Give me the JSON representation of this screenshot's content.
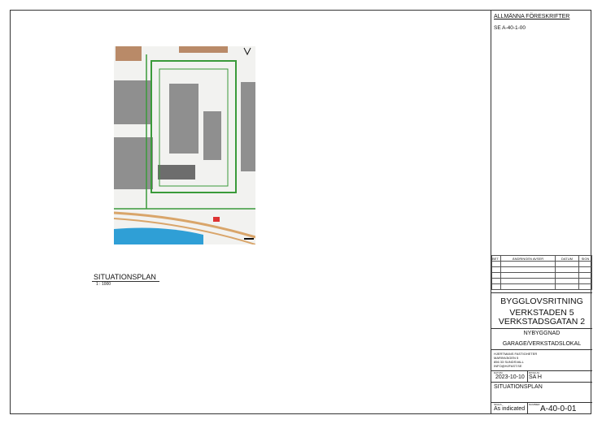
{
  "notes": {
    "heading": "ALLMÄNNA FÖRESKRIFTER",
    "ref": "SE A-40-1-00"
  },
  "view": {
    "title": "SITUATIONSPLAN",
    "scale": "1 : 1000"
  },
  "revision": {
    "headers": [
      "BET",
      "ÄNDRINGEN AVSER",
      "DATUM",
      "SIGN"
    ]
  },
  "titleblock": {
    "doc_type": "BYGGLOVSRITNING",
    "project_line1": "VERKSTADEN 5",
    "project_line2": "VERKSTADSGATAN 2",
    "subtitle1": "NYBYGGNAD",
    "subtitle2": "GARAGE/VERKSTADSLOKAL",
    "client": [
      "HJERTMANS FASTIGHETER",
      "MARINVÄGEN 5",
      "856 33 SUNDSVALL",
      "INFO@HJFAST.SE"
    ],
    "date_label": "DATUM",
    "date": "2023-10-10",
    "drawn_label": "RITAD AV",
    "drawn_by": "SA H",
    "drawing_title": "SITUATIONSPLAN",
    "scale_label": "SKALA",
    "scale": "As indicated",
    "number_label": "NUMMER",
    "number": "A-40-0-01"
  }
}
